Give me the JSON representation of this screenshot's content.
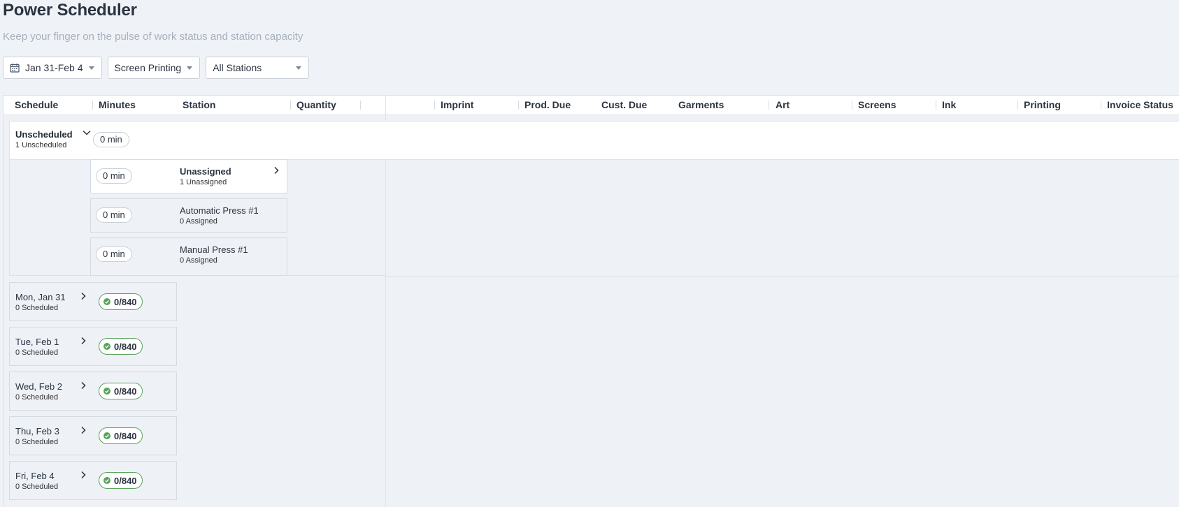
{
  "page": {
    "title": "Power Scheduler",
    "subtitle": "Keep your finger on the pulse of work status and station capacity"
  },
  "filters": {
    "date_range": "Jan 31-Feb 4",
    "process": "Screen Printing",
    "stations": "All Stations"
  },
  "columns": [
    "Schedule",
    "Minutes",
    "Station",
    "Quantity",
    "Imprint",
    "Prod. Due",
    "Cust. Due",
    "Garments",
    "Art",
    "Screens",
    "Ink",
    "Printing",
    "Invoice Status"
  ],
  "unscheduled": {
    "label": "Unscheduled",
    "sub": "1 Unscheduled",
    "minutes": "0 min",
    "stations": [
      {
        "name": "Unassigned",
        "sub": "1 Unassigned",
        "minutes": "0 min"
      },
      {
        "name": "Automatic Press #1",
        "sub": "0 Assigned",
        "minutes": "0 min"
      },
      {
        "name": "Manual Press #1",
        "sub": "0 Assigned",
        "minutes": "0 min"
      }
    ]
  },
  "days": [
    {
      "name": "Mon, Jan 31",
      "sub": "0 Scheduled",
      "capacity": "0/840"
    },
    {
      "name": "Tue, Feb 1",
      "sub": "0 Scheduled",
      "capacity": "0/840"
    },
    {
      "name": "Wed, Feb 2",
      "sub": "0 Scheduled",
      "capacity": "0/840"
    },
    {
      "name": "Thu, Feb 3",
      "sub": "0 Scheduled",
      "capacity": "0/840"
    },
    {
      "name": "Fri, Feb 4",
      "sub": "0 Scheduled",
      "capacity": "0/840"
    }
  ],
  "colors": {
    "background": "#eff2f7",
    "capacity_ok": "#5aa45b",
    "subtitle": "#a7b1bc"
  },
  "icons": {
    "date": "calendar-icon",
    "dropdown": "caret-down-icon",
    "expand": "chevron-down-icon",
    "open": "chevron-right-icon",
    "capacity": "check-circle-icon"
  }
}
